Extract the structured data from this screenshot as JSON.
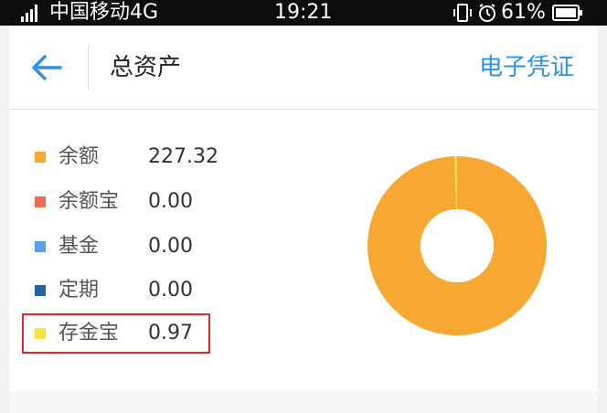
{
  "status_bar": {
    "carrier": "中国移动4G",
    "time": "19:21",
    "battery": "61%"
  },
  "nav": {
    "title": "总资产",
    "action_label": "电子凭证"
  },
  "colors": {
    "accent": "#2c93e6",
    "highlight": "#d9282e"
  },
  "assets": [
    {
      "name": "余额",
      "value": "227.32",
      "color": "#f7a833"
    },
    {
      "name": "余额宝",
      "value": "0.00",
      "color": "#ef6a4f"
    },
    {
      "name": "基金",
      "value": "0.00",
      "color": "#5b9ef0"
    },
    {
      "name": "定期",
      "value": "0.00",
      "color": "#2463a8"
    },
    {
      "name": "存金宝",
      "value": "0.97",
      "color": "#f5e23a"
    }
  ],
  "chart_data": {
    "type": "pie",
    "categories": [
      "余额",
      "余额宝",
      "基金",
      "定期",
      "存金宝"
    ],
    "values": [
      227.32,
      0.0,
      0.0,
      0.0,
      0.97
    ]
  }
}
